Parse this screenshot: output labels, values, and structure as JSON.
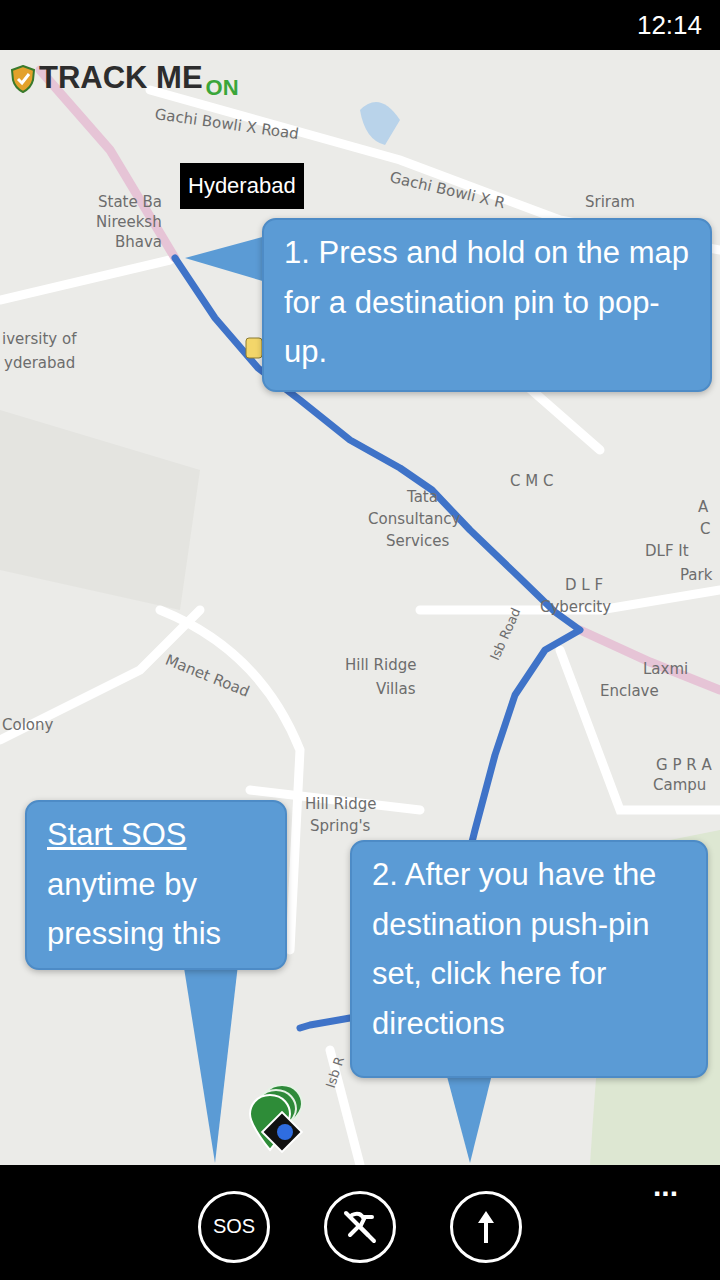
{
  "status_bar": {
    "time": "12:14"
  },
  "logo": {
    "text": "TRACK ME",
    "suffix": "ON"
  },
  "map": {
    "pin_label": "Hyderabad",
    "labels": [
      {
        "text": "Gachi Bowli X Road"
      },
      {
        "text": "Gachi Bowli X R"
      },
      {
        "text": "Sriram"
      },
      {
        "text": "State Ba"
      },
      {
        "text": "Nireeksh"
      },
      {
        "text": "Bhava"
      },
      {
        "text": "iversity of"
      },
      {
        "text": "yderabad"
      },
      {
        "text": "C M C"
      },
      {
        "text": "Tata"
      },
      {
        "text": "Consultancy"
      },
      {
        "text": "Services"
      },
      {
        "text": "A"
      },
      {
        "text": "C"
      },
      {
        "text": "DLF It"
      },
      {
        "text": "Park"
      },
      {
        "text": "D L F"
      },
      {
        "text": "Cybercity"
      },
      {
        "text": "Laxmi"
      },
      {
        "text": "Enclave"
      },
      {
        "text": "Manet Road"
      },
      {
        "text": "Hill Ridge"
      },
      {
        "text": "Villas"
      },
      {
        "text": "Colony"
      },
      {
        "text": "G P R A"
      },
      {
        "text": "Campu"
      },
      {
        "text": "Hill Ridge"
      },
      {
        "text": "Spring's"
      },
      {
        "text": "Isb Road"
      },
      {
        "text": "Isb R"
      }
    ]
  },
  "callouts": {
    "destination": {
      "text": "1. Press and hold on the map for a destination pin to pop-up."
    },
    "sos": {
      "emphasis": "Start SOS",
      "text": "anytime by pressing this"
    },
    "directions": {
      "text": "2. After you have the destination push-pin set, click here for directions"
    }
  },
  "app_bar": {
    "buttons": [
      {
        "kind": "sos",
        "text": "SOS"
      },
      {
        "kind": "no-tracking"
      },
      {
        "kind": "directions"
      }
    ],
    "more": "..."
  }
}
